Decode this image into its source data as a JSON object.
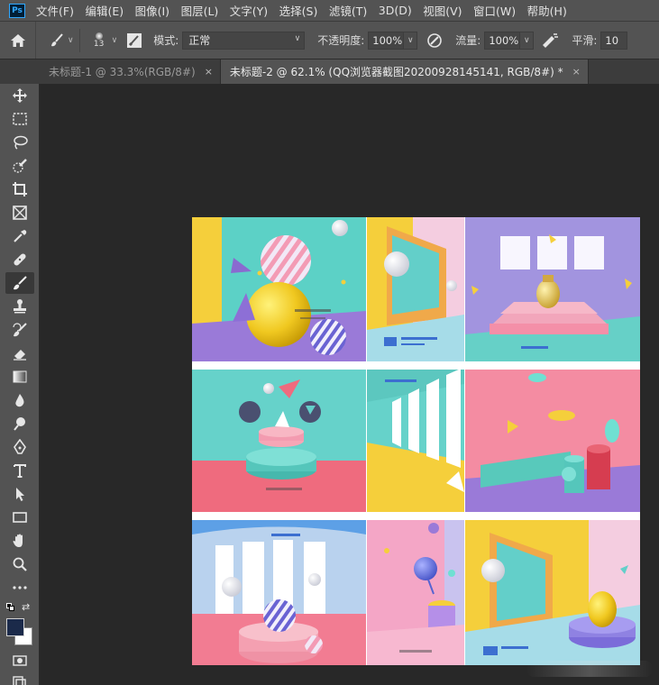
{
  "menu": {
    "logo": "Ps",
    "items": [
      "文件(F)",
      "编辑(E)",
      "图像(I)",
      "图层(L)",
      "文字(Y)",
      "选择(S)",
      "滤镜(T)",
      "3D(D)",
      "视图(V)",
      "窗口(W)",
      "帮助(H)"
    ]
  },
  "options": {
    "brush_size": "13",
    "mode_label": "模式:",
    "mode_value": "正常",
    "opacity_label": "不透明度:",
    "opacity_value": "100%",
    "flow_label": "流量:",
    "flow_value": "100%",
    "smoothing_label": "平滑:",
    "smoothing_value": "10"
  },
  "tabs": [
    {
      "title": "未标题-1 @ 33.3%(RGB/8#)",
      "close": "×"
    },
    {
      "title": "未标题-2 @ 62.1% (QQ浏览器截图20200928145141, RGB/8#) *",
      "close": "×"
    }
  ],
  "tools": [
    "move-tool",
    "marquee-tool",
    "lasso-tool",
    "quick-select-tool",
    "crop-tool",
    "frame-tool",
    "eyedropper-tool",
    "healing-brush-tool",
    "brush-tool",
    "clone-stamp-tool",
    "history-brush-tool",
    "eraser-tool",
    "gradient-tool",
    "blur-tool",
    "dodge-tool",
    "pen-tool",
    "type-tool",
    "path-select-tool",
    "rectangle-tool",
    "hand-tool",
    "zoom-tool",
    "more-tools"
  ],
  "colors": {
    "foreground": "#1b2a4a",
    "background": "#ffffff",
    "ui_dark": "#535353",
    "canvas_bg": "#282828",
    "accent": "#31a8ff"
  }
}
